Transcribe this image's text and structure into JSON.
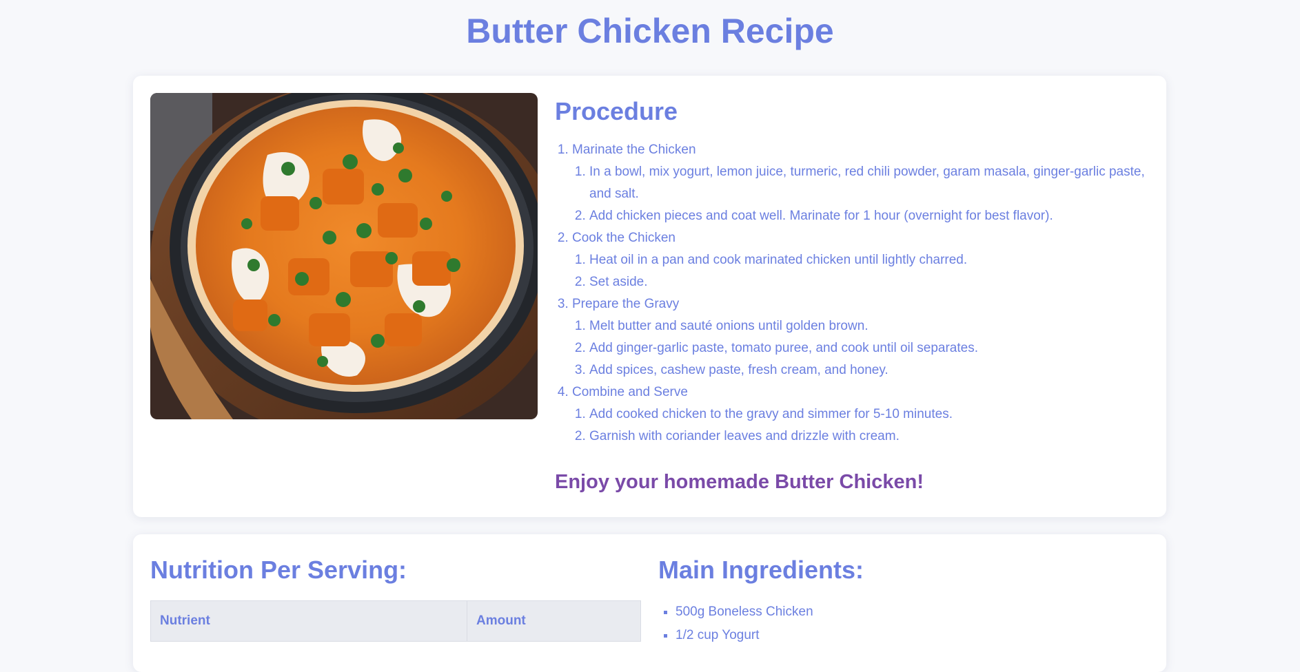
{
  "page": {
    "title": "Butter Chicken Recipe"
  },
  "image": {
    "alt": "Butter Chicken"
  },
  "procedure": {
    "heading": "Procedure",
    "steps": [
      {
        "title": "Marinate the Chicken",
        "substeps": [
          "In a bowl, mix yogurt, lemon juice, turmeric, red chili powder, garam masala, ginger-garlic paste, and salt.",
          "Add chicken pieces and coat well. Marinate for 1 hour (overnight for best flavor)."
        ]
      },
      {
        "title": "Cook the Chicken",
        "substeps": [
          "Heat oil in a pan and cook marinated chicken until lightly charred.",
          "Set aside."
        ]
      },
      {
        "title": "Prepare the Gravy",
        "substeps": [
          "Melt butter and sauté onions until golden brown.",
          "Add ginger-garlic paste, tomato puree, and cook until oil separates.",
          "Add spices, cashew paste, fresh cream, and honey."
        ]
      },
      {
        "title": "Combine and Serve",
        "substeps": [
          "Add cooked chicken to the gravy and simmer for 5-10 minutes.",
          "Garnish with coriander leaves and drizzle with cream."
        ]
      }
    ],
    "closing": "Enjoy your homemade Butter Chicken!"
  },
  "nutrition": {
    "heading": "Nutrition Per Serving:",
    "columns": [
      "Nutrient",
      "Amount"
    ]
  },
  "ingredients": {
    "heading": "Main Ingredients:",
    "items": [
      "500g Boneless Chicken",
      "1/2 cup Yogurt"
    ]
  },
  "colors": {
    "accent": "#6b7fe0",
    "closing": "#7a4aa8",
    "background": "#f7f8fb"
  }
}
